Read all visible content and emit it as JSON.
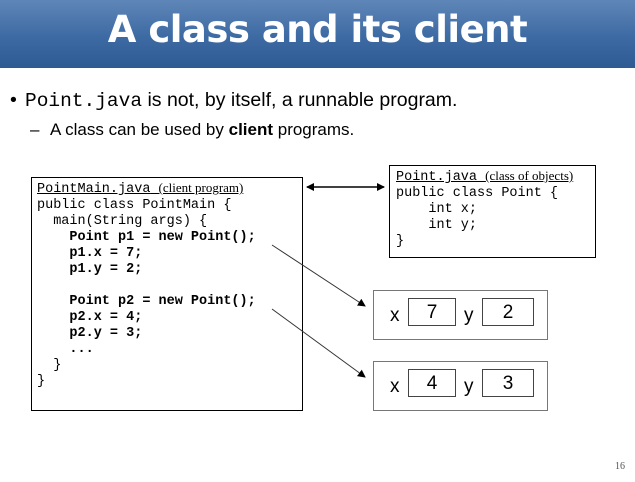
{
  "slide": {
    "title": "A class and its client",
    "page_number": "16"
  },
  "bullets": {
    "b1_code": "Point.java",
    "b1_text": " is not, by itself, a runnable program.",
    "b2_pre": "A class can be used by ",
    "b2_bold": "client",
    "b2_post": " programs."
  },
  "client_box": {
    "file": "PointMain.java",
    "note": "(client program)",
    "lines": [
      "public class PointMain {",
      "  main(String args) {",
      "    Point p1 = new Point();",
      "    p1.x = 7;",
      "    p1.y = 2;",
      "",
      "    Point p2 = new Point();",
      "    p2.x = 4;",
      "    p2.y = 3;",
      "    ...",
      "  }",
      "}"
    ]
  },
  "point_box": {
    "file": "Point.java",
    "note": "(class of objects)",
    "lines": [
      "public class Point {",
      "    int x;",
      "    int y;",
      "}"
    ]
  },
  "objects": [
    {
      "x_label": "x",
      "x_value": "7",
      "y_label": "y",
      "y_value": "2"
    },
    {
      "x_label": "x",
      "x_value": "4",
      "y_label": "y",
      "y_value": "3"
    }
  ]
}
